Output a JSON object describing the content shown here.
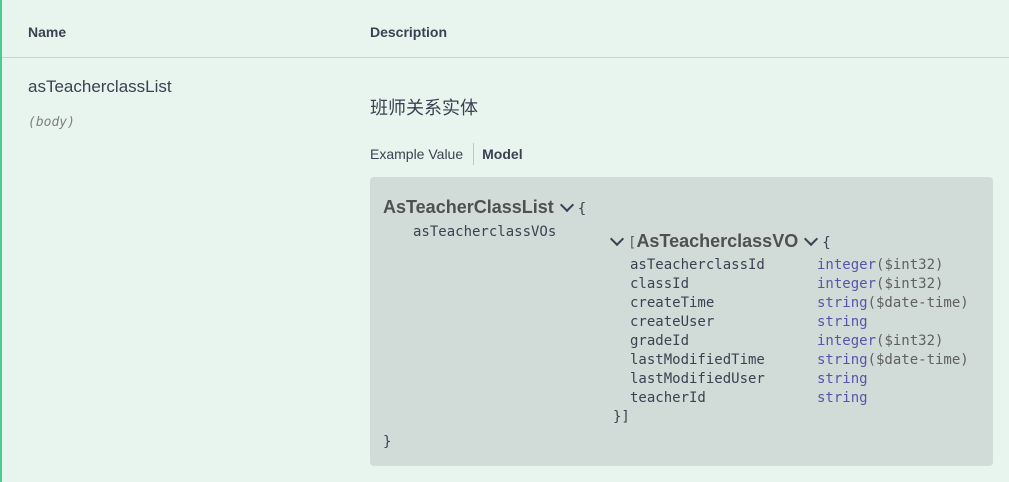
{
  "table": {
    "col_name": "Name",
    "col_description": "Description"
  },
  "param": {
    "name": "asTeacherclassList",
    "in": "(body)",
    "description": "班师关系实体"
  },
  "tabs": {
    "example_value": "Example Value",
    "model": "Model"
  },
  "model": {
    "title": "AsTeacherClassList",
    "open_brace": "{",
    "close_brace": "}",
    "field_name": "asTeacherclassVOs",
    "array_open": "[",
    "array_close": "}]",
    "inner_title": "AsTeacherclassVO",
    "inner_open": "{",
    "properties": [
      {
        "name": "asTeacherclassId",
        "type": "integer",
        "format": "($int32)"
      },
      {
        "name": "classId",
        "type": "integer",
        "format": "($int32)"
      },
      {
        "name": "createTime",
        "type": "string",
        "format": "($date-time)"
      },
      {
        "name": "createUser",
        "type": "string",
        "format": ""
      },
      {
        "name": "gradeId",
        "type": "integer",
        "format": "($int32)"
      },
      {
        "name": "lastModifiedTime",
        "type": "string",
        "format": "($date-time)"
      },
      {
        "name": "lastModifiedUser",
        "type": "string",
        "format": ""
      },
      {
        "name": "teacherId",
        "type": "string",
        "format": ""
      }
    ]
  },
  "colors": {
    "background": "#e8f5ef",
    "accent_border": "#49cc90",
    "model_box": "#d1dcd8",
    "type_text": "#55a"
  }
}
